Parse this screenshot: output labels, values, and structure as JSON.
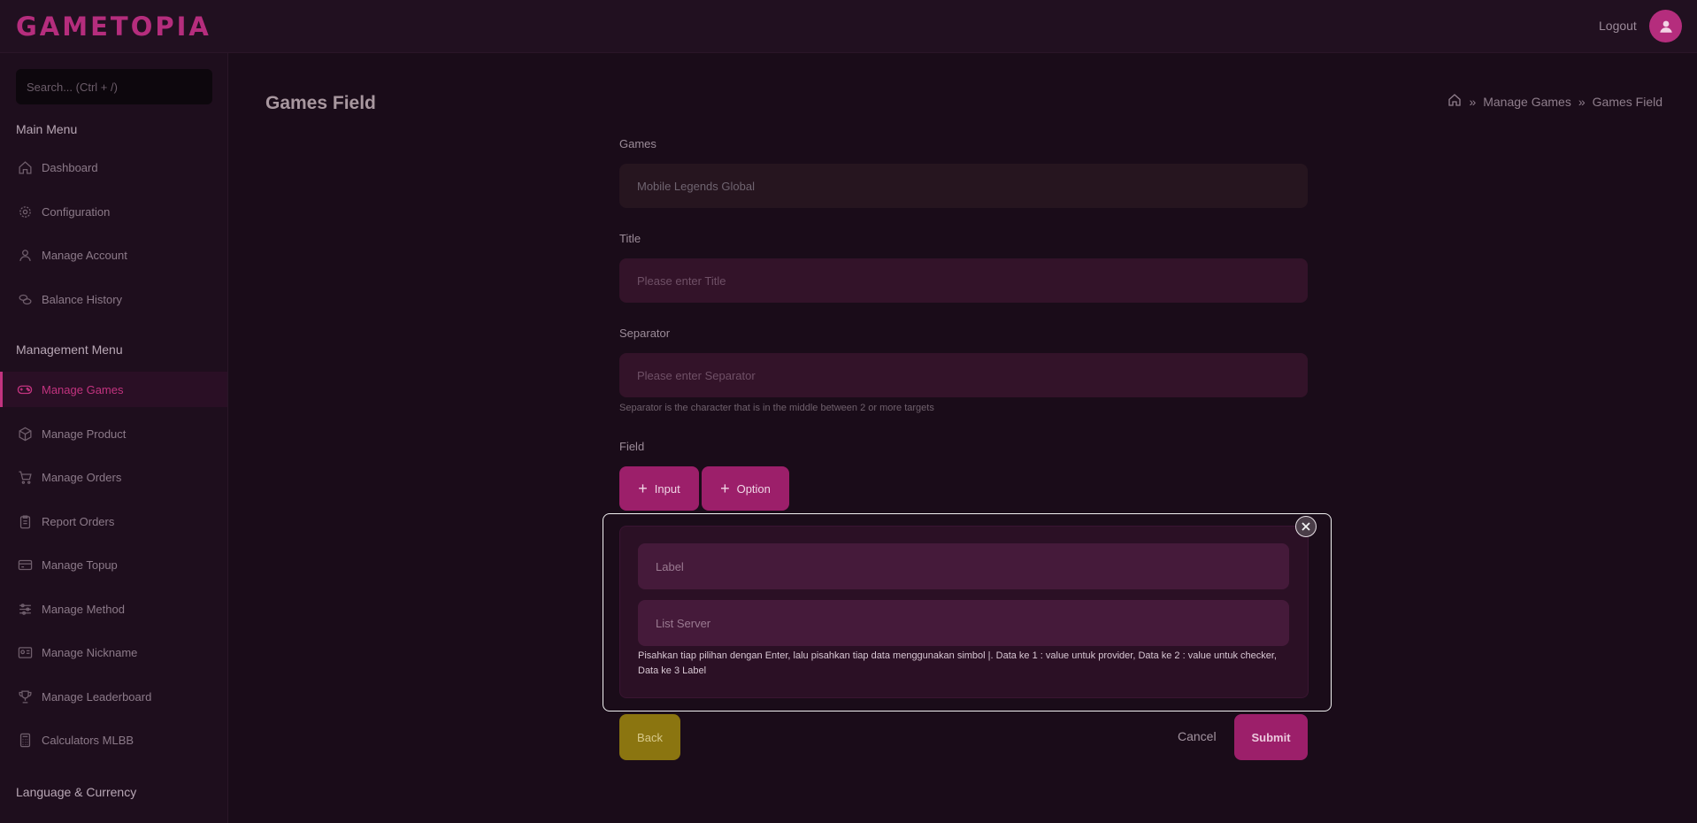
{
  "app": {
    "logo": "GAMETOPIA",
    "logout": "Logout"
  },
  "sidebar": {
    "search_placeholder": "Search... (Ctrl + /)",
    "main_menu_heading": "Main Menu",
    "main_items": [
      {
        "label": "Dashboard",
        "icon": "home-icon"
      },
      {
        "label": "Configuration",
        "icon": "gear-icon"
      },
      {
        "label": "Manage Account",
        "icon": "user-icon"
      },
      {
        "label": "Balance History",
        "icon": "coins-icon"
      }
    ],
    "management_menu_heading": "Management Menu",
    "management_items": [
      {
        "label": "Manage Games",
        "icon": "gamepad-icon",
        "active": true
      },
      {
        "label": "Manage Product",
        "icon": "box-icon"
      },
      {
        "label": "Manage Orders",
        "icon": "cart-icon"
      },
      {
        "label": "Report Orders",
        "icon": "clipboard-icon"
      },
      {
        "label": "Manage Topup",
        "icon": "card-icon"
      },
      {
        "label": "Manage Method",
        "icon": "sliders-icon"
      },
      {
        "label": "Manage Nickname",
        "icon": "id-card-icon"
      },
      {
        "label": "Manage Leaderboard",
        "icon": "trophy-icon"
      },
      {
        "label": "Calculators MLBB",
        "icon": "calculator-icon"
      }
    ],
    "language_heading": "Language & Currency"
  },
  "page": {
    "title": "Games Field",
    "breadcrumb": [
      "Manage Games",
      "Games Field"
    ]
  },
  "form": {
    "games_label": "Games",
    "games_value": "Mobile Legends Global",
    "title_label": "Title",
    "title_placeholder": "Please enter Title",
    "separator_label": "Separator",
    "separator_placeholder": "Please enter Separator",
    "separator_hint": "Separator is the character that is in the middle between 2 or more targets",
    "field_label": "Field",
    "add_input_label": "Input",
    "add_option_label": "Option",
    "option_panel": {
      "label_placeholder": "Label",
      "list_placeholder": "List Server",
      "hint": "Pisahkan tiap pilihan dengan Enter, lalu pisahkan tiap data menggunakan simbol |. Data ke 1 : value untuk provider, Data ke 2 : value untuk checker, Data ke 3 Label"
    },
    "back_label": "Back",
    "cancel_label": "Cancel",
    "submit_label": "Submit"
  },
  "colors": {
    "accent": "#b52d7d",
    "background": "#1a0c19",
    "back_button": "#8b7510"
  }
}
